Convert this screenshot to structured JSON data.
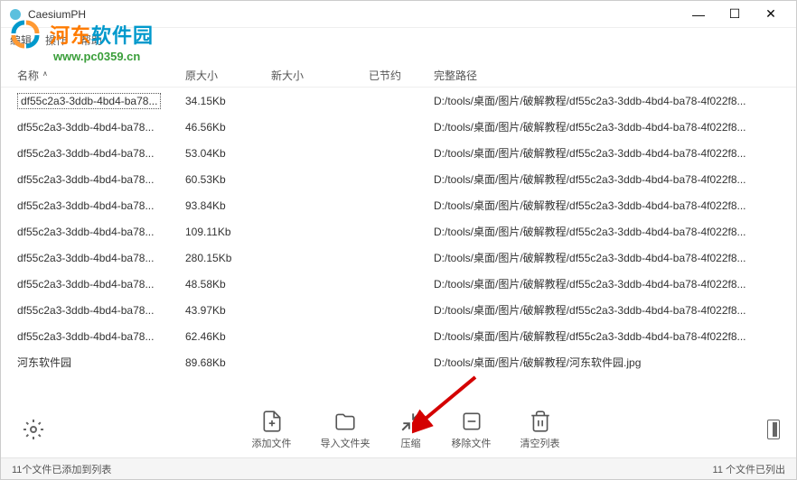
{
  "window": {
    "title": "CaesiumPH"
  },
  "menu": {
    "edit": "编辑",
    "action": "操作",
    "help": "帮助"
  },
  "watermark": {
    "site_name": "河东软件园",
    "url": "www.pc0359.cn"
  },
  "columns": {
    "name": "名称",
    "origsize": "原大小",
    "newsize": "新大小",
    "saved": "已节约",
    "path": "完整路径"
  },
  "rows": [
    {
      "name": "df55c2a3-3ddb-4bd4-ba78...",
      "origsize": "34.15Kb",
      "path": "D:/tools/桌面/图片/破解教程/df55c2a3-3ddb-4bd4-ba78-4f022f8..."
    },
    {
      "name": "df55c2a3-3ddb-4bd4-ba78...",
      "origsize": "46.56Kb",
      "path": "D:/tools/桌面/图片/破解教程/df55c2a3-3ddb-4bd4-ba78-4f022f8..."
    },
    {
      "name": "df55c2a3-3ddb-4bd4-ba78...",
      "origsize": "53.04Kb",
      "path": "D:/tools/桌面/图片/破解教程/df55c2a3-3ddb-4bd4-ba78-4f022f8..."
    },
    {
      "name": "df55c2a3-3ddb-4bd4-ba78...",
      "origsize": "60.53Kb",
      "path": "D:/tools/桌面/图片/破解教程/df55c2a3-3ddb-4bd4-ba78-4f022f8..."
    },
    {
      "name": "df55c2a3-3ddb-4bd4-ba78...",
      "origsize": "93.84Kb",
      "path": "D:/tools/桌面/图片/破解教程/df55c2a3-3ddb-4bd4-ba78-4f022f8..."
    },
    {
      "name": "df55c2a3-3ddb-4bd4-ba78...",
      "origsize": "109.11Kb",
      "path": "D:/tools/桌面/图片/破解教程/df55c2a3-3ddb-4bd4-ba78-4f022f8..."
    },
    {
      "name": "df55c2a3-3ddb-4bd4-ba78...",
      "origsize": "280.15Kb",
      "path": "D:/tools/桌面/图片/破解教程/df55c2a3-3ddb-4bd4-ba78-4f022f8..."
    },
    {
      "name": "df55c2a3-3ddb-4bd4-ba78...",
      "origsize": "48.58Kb",
      "path": "D:/tools/桌面/图片/破解教程/df55c2a3-3ddb-4bd4-ba78-4f022f8..."
    },
    {
      "name": "df55c2a3-3ddb-4bd4-ba78...",
      "origsize": "43.97Kb",
      "path": "D:/tools/桌面/图片/破解教程/df55c2a3-3ddb-4bd4-ba78-4f022f8..."
    },
    {
      "name": "df55c2a3-3ddb-4bd4-ba78...",
      "origsize": "62.46Kb",
      "path": "D:/tools/桌面/图片/破解教程/df55c2a3-3ddb-4bd4-ba78-4f022f8..."
    },
    {
      "name": "河东软件园",
      "origsize": "89.68Kb",
      "path": "D:/tools/桌面/图片/破解教程/河东软件园.jpg"
    }
  ],
  "toolbar": {
    "add_file": "添加文件",
    "import_folder": "导入文件夹",
    "compress": "压缩",
    "remove_file": "移除文件",
    "clear_list": "清空列表"
  },
  "status": {
    "left": "11个文件已添加到列表",
    "right": "11 个文件已列出"
  }
}
